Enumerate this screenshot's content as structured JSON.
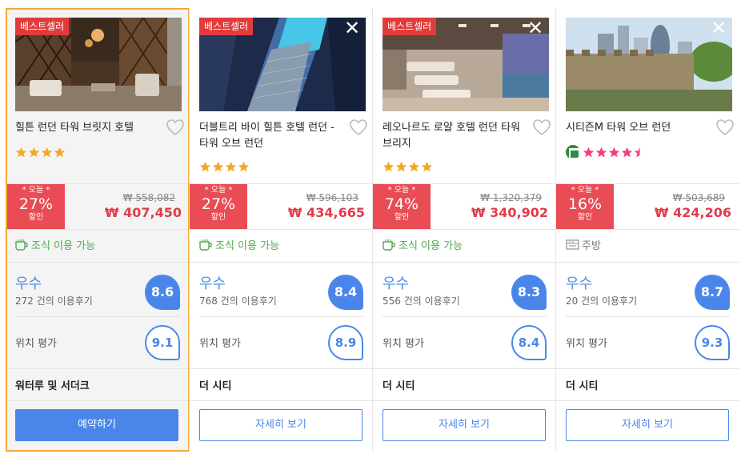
{
  "colors": {
    "accent": "#4a86ea",
    "discount": "#e94c55",
    "highlight_border": "#f3a838",
    "green": "#4da94d"
  },
  "hotels": [
    {
      "badge": "베스트셀러",
      "name": "힐튼 런던 타워 브릿지 호텔",
      "star_rating": 4,
      "star_color": "#f5a623",
      "discount_today": "* 오늘 *",
      "discount_pct": "27%",
      "discount_off": "할인",
      "original_price": "₩ 558,082",
      "price": "₩ 407,450",
      "amenity": "조식 이용 가능",
      "amenity_icon": "coffee-icon",
      "rating_word": "우수",
      "review_count": "272 건의 이용후기",
      "score": "8.6",
      "location_label": "위치 평가",
      "location_score": "9.1",
      "area": "워터루 및 서더크",
      "button": "예약하기"
    },
    {
      "badge": "베스트셀러",
      "name": "더블트리 바이 힐튼 호텔 런던 - 타워 오브 런던",
      "star_rating": 4,
      "star_color": "#f5a623",
      "discount_today": "* 오늘 *",
      "discount_pct": "27%",
      "discount_off": "할인",
      "original_price": "₩ 596,103",
      "price": "₩ 434,665",
      "amenity": "조식 이용 가능",
      "amenity_icon": "coffee-icon",
      "rating_word": "우수",
      "review_count": "768 건의 이용후기",
      "score": "8.4",
      "location_label": "위치 평가",
      "location_score": "8.9",
      "area": "더 시티",
      "button": "자세히 보기"
    },
    {
      "badge": "베스트셀러",
      "name": "레오나르도 로얄 호텔 런던 타워 브리지",
      "star_rating": 4,
      "star_color": "#f5a623",
      "discount_today": "* 오늘 *",
      "discount_pct": "74%",
      "discount_off": "할인",
      "original_price": "₩ 1,320,379",
      "price": "₩ 340,902",
      "amenity": "조식 이용 가능",
      "amenity_icon": "coffee-icon",
      "rating_word": "우수",
      "review_count": "556 건의 이용후기",
      "score": "8.3",
      "location_label": "위치 평가",
      "location_score": "8.4",
      "area": "더 시티",
      "button": "자세히 보기"
    },
    {
      "badge": "",
      "name": "시티즌M 타워 오브 런던",
      "star_rating": 4.5,
      "star_color": "#f0427a",
      "discount_today": "* 오늘 *",
      "discount_pct": "16%",
      "discount_off": "할인",
      "original_price": "₩ 503,689",
      "price": "₩ 424,206",
      "amenity": "주방",
      "amenity_icon": "kitchen-icon",
      "rating_word": "우수",
      "review_count": "20 건의 이용후기",
      "score": "8.7",
      "location_label": "위치 평가",
      "location_score": "9.3",
      "area": "더 시티",
      "button": "자세히 보기"
    }
  ]
}
